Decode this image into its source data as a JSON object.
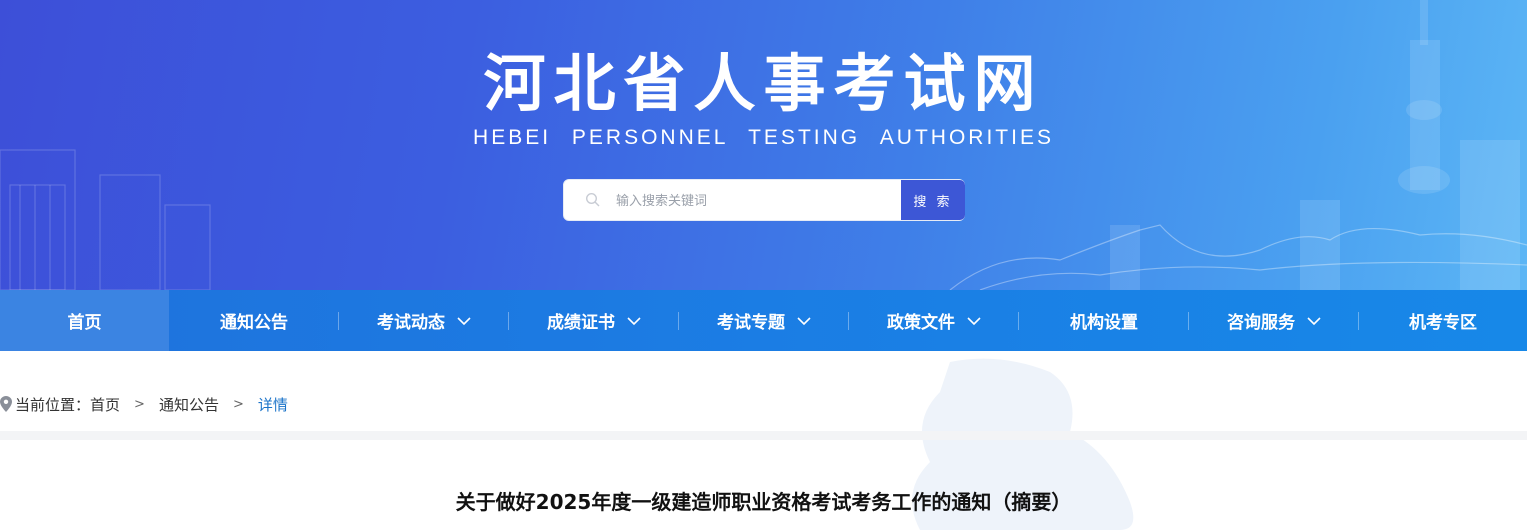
{
  "header": {
    "title": "河北省人事考试网",
    "subtitle": "HEBEI PERSONNEL TESTING AUTHORITIES"
  },
  "search": {
    "placeholder": "输入搜索关键词",
    "value": "",
    "button_label": "搜 索"
  },
  "nav": {
    "items": [
      {
        "label": "首页",
        "dropdown": false,
        "active": true
      },
      {
        "label": "通知公告",
        "dropdown": false
      },
      {
        "label": "考试动态",
        "dropdown": true
      },
      {
        "label": "成绩证书",
        "dropdown": true
      },
      {
        "label": "考试专题",
        "dropdown": true
      },
      {
        "label": "政策文件",
        "dropdown": true
      },
      {
        "label": "机构设置",
        "dropdown": false
      },
      {
        "label": "咨询服务",
        "dropdown": true
      },
      {
        "label": "机考专区",
        "dropdown": false
      }
    ]
  },
  "breadcrumb": {
    "prefix": "当前位置：",
    "items": [
      "首页",
      "通知公告",
      "详情"
    ],
    "separator": ">"
  },
  "article": {
    "title": "关于做好2025年度一级建造师职业资格考试考务工作的通知（摘要）"
  },
  "colors": {
    "banner_start": "#3d4fd8",
    "banner_end": "#5cb6f5",
    "nav_bg": "#1b7de4",
    "nav_active": "#3b84e2",
    "breadcrumb_current": "#1a73c9"
  }
}
